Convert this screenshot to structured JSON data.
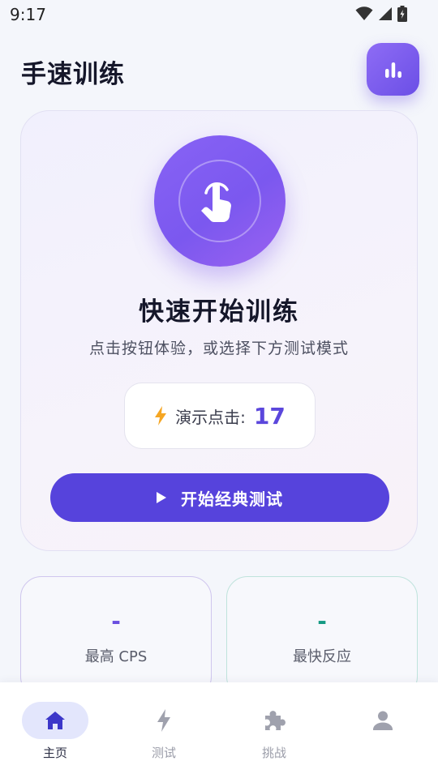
{
  "status_bar": {
    "time": "9:17"
  },
  "header": {
    "title": "手速训练"
  },
  "hero": {
    "title": "快速开始训练",
    "subtitle": "点击按钮体验，或选择下方测试模式",
    "demo_label": "演示点击:",
    "demo_count": "17",
    "start_button": "开始经典测试"
  },
  "stats": [
    {
      "value": "-",
      "label": "最高 CPS",
      "color": "#6a4fe0"
    },
    {
      "value": "-",
      "label": "最快反应",
      "color": "#169a84"
    }
  ],
  "nav": {
    "items": [
      {
        "label": "主页",
        "icon": "home-icon"
      },
      {
        "label": "测试",
        "icon": "lightning-icon"
      },
      {
        "label": "挑战",
        "icon": "puzzle-icon"
      },
      {
        "label": "",
        "icon": "person-icon"
      }
    ]
  },
  "colors": {
    "accent": "#5643dc",
    "hero_circle": "#7b58ef",
    "lightning": "#f5a623"
  }
}
